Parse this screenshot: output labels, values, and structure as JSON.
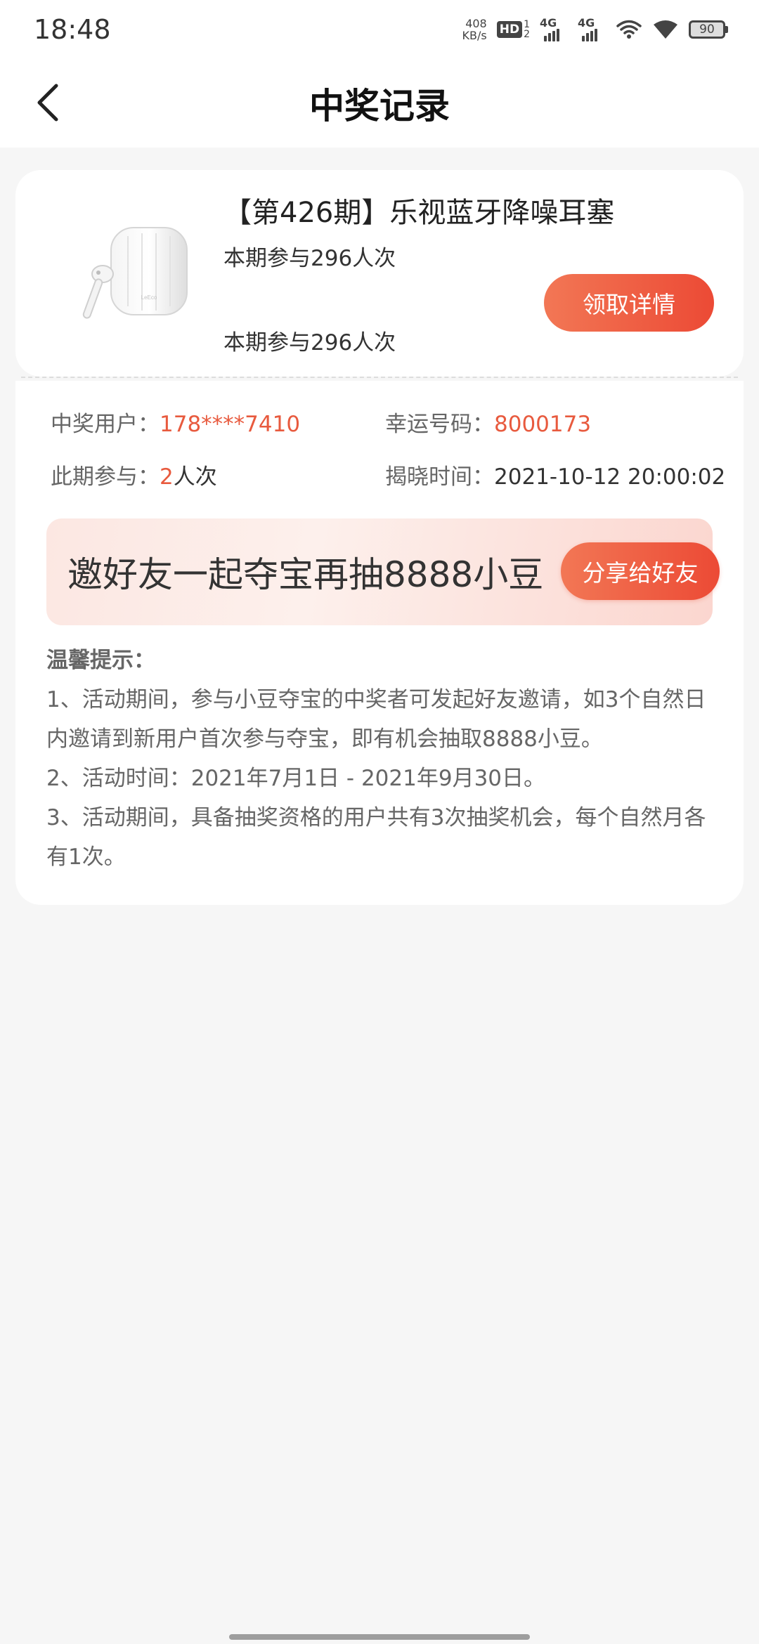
{
  "status_bar": {
    "time": "18:48",
    "net_speed_value": "408",
    "net_speed_unit": "KB/s",
    "hd_label": "HD",
    "hd_sim1": "1",
    "hd_sim2": "2",
    "signal1_label": "4G",
    "signal2_label": "4G",
    "battery_level": "90"
  },
  "nav": {
    "title": "中奖记录",
    "back_icon": "chevron-left-icon"
  },
  "product": {
    "title": "【第426期】乐视蓝牙降噪耳塞",
    "participation_1": "本期参与296人次",
    "participation_2": "本期参与296人次",
    "claim_button": "领取详情",
    "image": "earbuds-product-image",
    "image_brand": "LeEco"
  },
  "details": {
    "winner_label": "中奖用户：",
    "winner_value": "178****7410",
    "lucky_label": "幸运号码：",
    "lucky_value": "8000173",
    "participation_label": "此期参与：",
    "participation_count": "2",
    "participation_unit": "人次",
    "reveal_label": "揭晓时间：",
    "reveal_value": "2021-10-12 20:00:02"
  },
  "invite": {
    "text": "邀好友一起夺宝再抽8888小豆",
    "share_button": "分享给好友"
  },
  "tips": {
    "title": "温馨提示：",
    "line1": "1、活动期间，参与小豆夺宝的中奖者可发起好友邀请，如3个自然日内邀请到新用户首次参与夺宝，即有机会抽取8888小豆。",
    "line2": "2、活动时间：2021年7月1日 - 2021年9月30日。",
    "line3": "3、活动期间，具备抽奖资格的用户共有3次抽奖机会，每个自然月各有1次。"
  },
  "colors": {
    "accent": "#ec4a35",
    "accent_light": "#f27755",
    "highlight_text": "#e85a3e",
    "page_bg": "#f6f6f6"
  }
}
